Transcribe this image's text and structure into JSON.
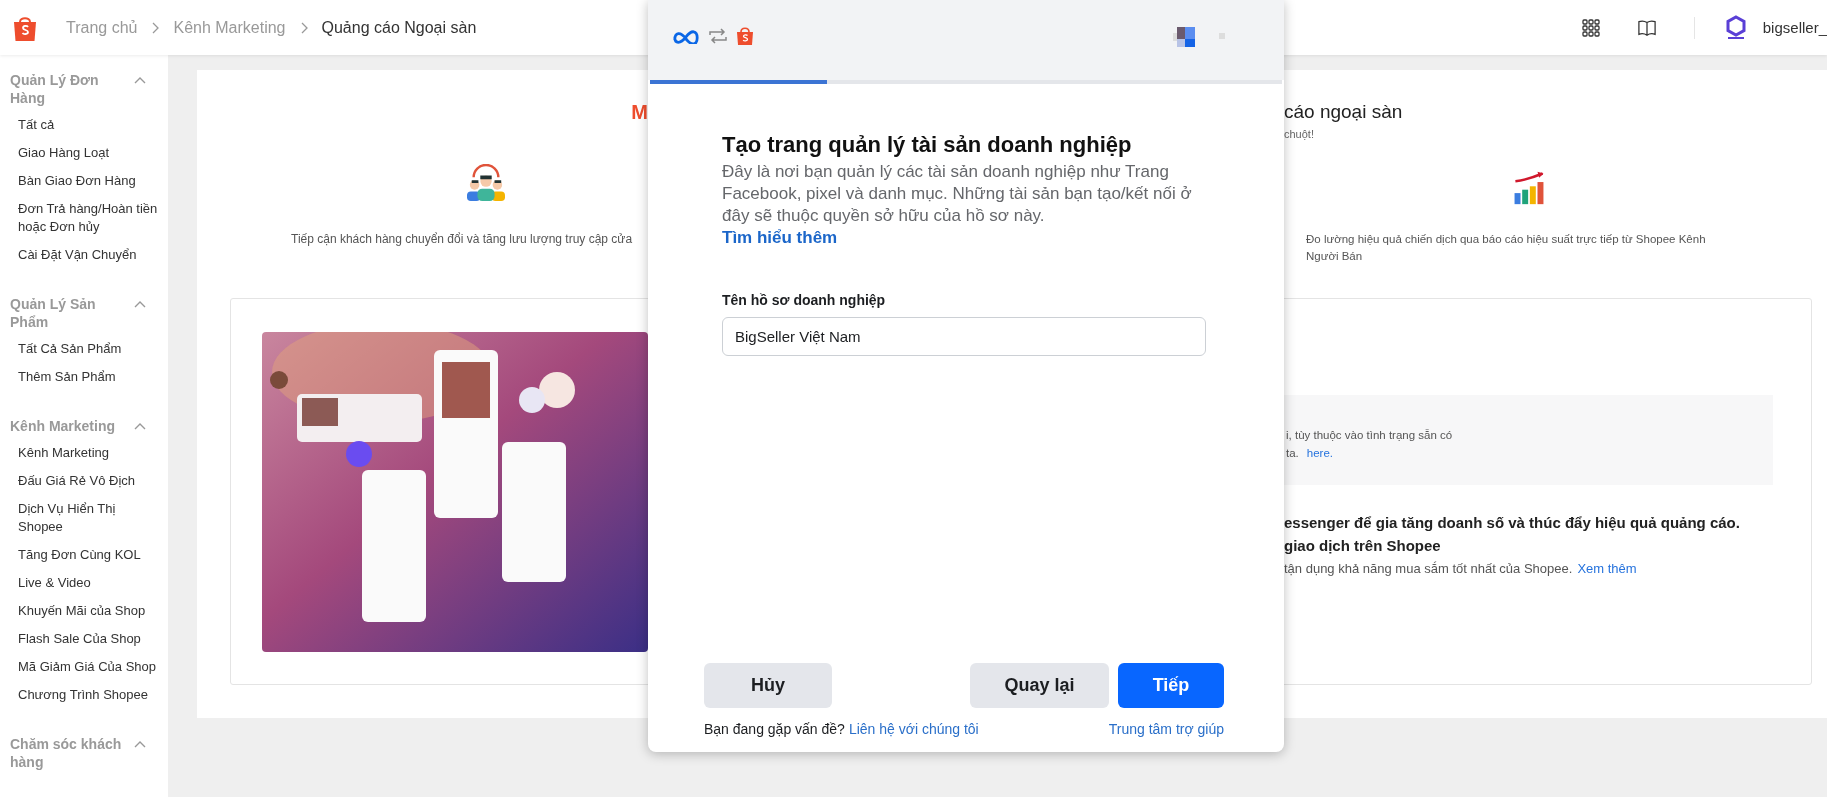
{
  "top_bar": {
    "breadcrumbs": [
      {
        "label": "Trang chủ"
      },
      {
        "label": "Kênh Marketing"
      },
      {
        "label": "Quảng cáo Ngoại sàn"
      }
    ],
    "username": "bigseller_"
  },
  "sidebar": {
    "groups": [
      {
        "title": "Quản Lý Đơn Hàng",
        "expanded": true,
        "items": [
          "Tất cả",
          "Giao Hàng Loạt",
          "Bàn Giao Đơn Hàng",
          "Đơn Trả hàng/Hoàn tiền hoặc Đơn hủy",
          "Cài Đặt Vận Chuyển"
        ]
      },
      {
        "title": "Quản Lý Sản Phẩm",
        "expanded": true,
        "items": [
          "Tất Cả Sản Phẩm",
          "Thêm Sản Phẩm"
        ]
      },
      {
        "title": "Kênh Marketing",
        "expanded": true,
        "items": [
          "Kênh Marketing",
          "Đấu Giá Rẻ Vô Địch",
          "Dịch Vụ Hiển Thị Shopee",
          "Tăng Đơn Cùng KOL",
          "Live & Video",
          "Khuyến Mãi của Shop",
          "Flash Sale Của Shop",
          "Mã Giảm Giá Của Shop",
          "Chương Trình Shopee"
        ]
      },
      {
        "title": "Chăm sóc khách hàng",
        "expanded": true
      }
    ]
  },
  "page": {
    "title_left": "M",
    "title_right": "cáo ngoại sàn",
    "subtitle": "chuột!",
    "feature_left": "Tiếp cận khách hàng chuyển đổi và tăng lưu lượng truy cập cửa",
    "feature_right": "Đo lường hiệu quả chiến dịch qua báo cáo hiệu suất trực tiếp từ Shopee Kênh Người Bán",
    "info_lines": [
      "i, tùy thuộc vào tình trạng sẵn có",
      "ta."
    ],
    "info_link": "here.",
    "headline_lines": [
      "essenger để gia tăng doanh số và thúc đẩy hiệu quả quảng cáo.",
      "giao dịch trên Shopee"
    ],
    "body": "tận dụng khả năng mua sắm tốt nhất của Shopee.",
    "body_link": "Xem thêm"
  },
  "modal": {
    "progress": {
      "level": 0.28
    },
    "title": "Tạo trang quản lý tài sản doanh nghiệp",
    "description": "Đây là nơi bạn quản lý các tài sản doanh nghiệp như Trang Facebook, pixel và danh mục. Những tài sản bạn tạo/kết nối ở đây sẽ thuộc quyền sở hữu của hồ sơ này.",
    "learn_more": "Tìm hiểu thêm",
    "field": {
      "label": "Tên hồ sơ doanh nghiệp",
      "value": "BigSeller Việt Nam"
    },
    "buttons": [
      {
        "label": "Hủy",
        "kind": "secondary"
      },
      {
        "label": "Quay lại",
        "kind": "secondary"
      },
      {
        "label": "Tiếp",
        "kind": "primary"
      }
    ],
    "help_prompt": "Bạn đang gặp vấn đề?",
    "contact_link": "Liên hệ với chúng tôi",
    "help_center": "Trung tâm trợ giúp"
  }
}
